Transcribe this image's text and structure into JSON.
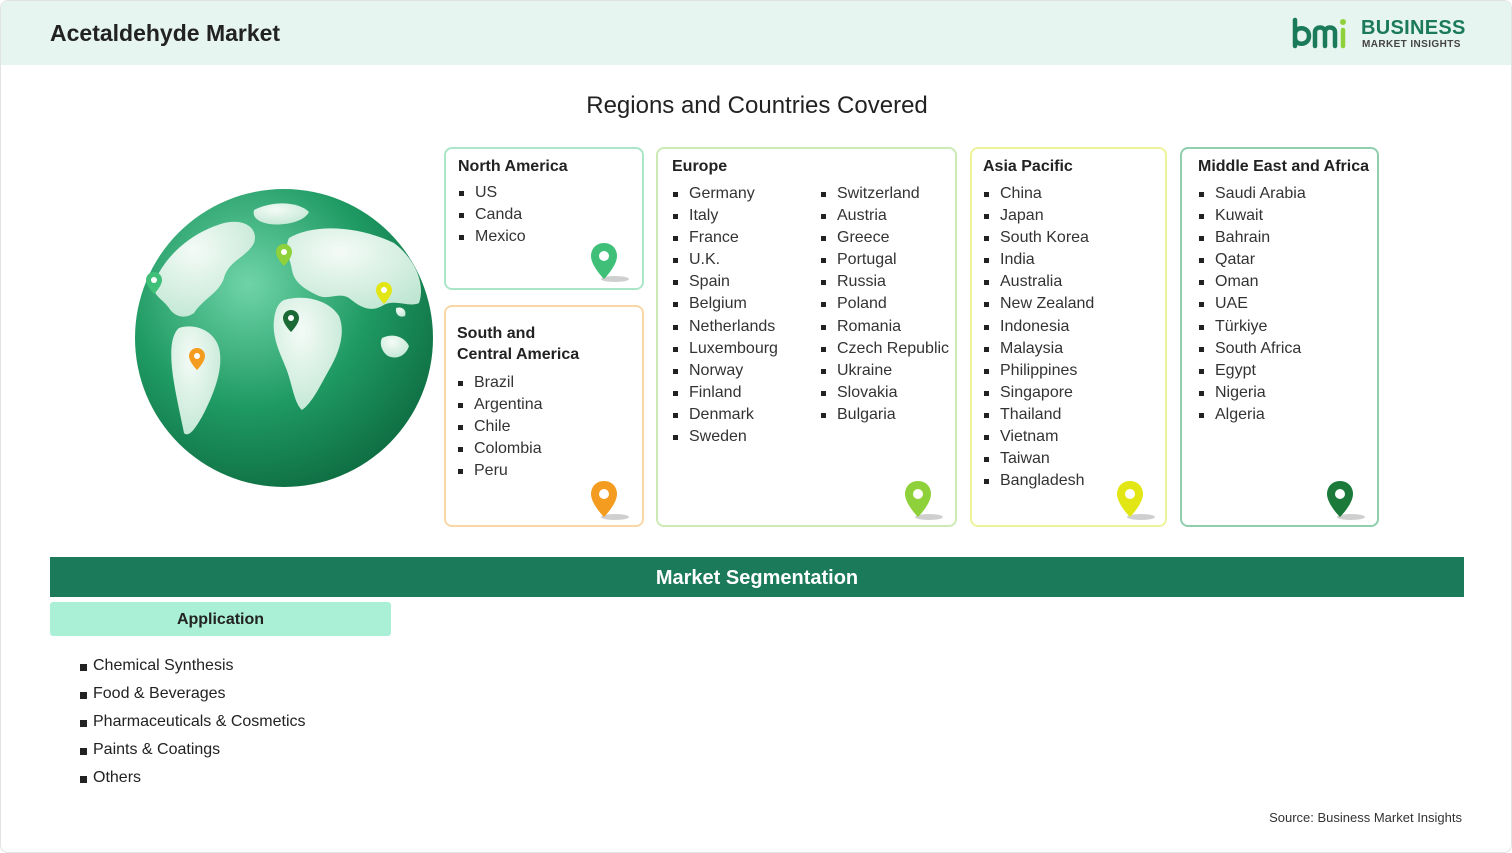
{
  "header": {
    "title": "Acetaldehyde Market"
  },
  "logo": {
    "line1": "BUSINESS",
    "line2": "MARKET INSIGHTS"
  },
  "regions_title": "Regions and Countries Covered",
  "regions": {
    "north_america": {
      "title": "North America",
      "pin_color": "#3fbf78",
      "items": [
        "US",
        "Canda",
        "Mexico"
      ]
    },
    "south_central_america": {
      "title_line1": "South and",
      "title_line2": "Central America",
      "pin_color": "#f39c1f",
      "items": [
        "Brazil",
        "Argentina",
        "Chile",
        "Colombia",
        "Peru"
      ]
    },
    "europe": {
      "title": "Europe",
      "pin_color": "#8fd13a",
      "col1": [
        "Germany",
        "Italy",
        "France",
        "U.K.",
        "Spain",
        "Belgium",
        "Netherlands",
        "Luxembourg",
        "Norway",
        "Finland",
        "Denmark",
        "Sweden"
      ],
      "col2": [
        "Switzerland",
        "Austria",
        "Greece",
        "Portugal",
        "Russia",
        "Poland",
        "Romania",
        "Czech Republic",
        "Ukraine",
        "Slovakia",
        "Bulgaria"
      ]
    },
    "asia_pacific": {
      "title": "Asia Pacific",
      "pin_color": "#e3e615",
      "items": [
        "China",
        "Japan",
        "South Korea",
        "India",
        "Australia",
        "New Zealand",
        "Indonesia",
        "Malaysia",
        "Philippines",
        "Singapore",
        "Thailand",
        "Vietnam",
        "Taiwan",
        "Bangladesh"
      ]
    },
    "mea": {
      "title": "Middle East and Africa",
      "pin_color": "#1b7a3a",
      "items": [
        "Saudi Arabia",
        "Kuwait",
        "Bahrain",
        "Qatar",
        "Oman",
        "UAE",
        "Türkiye",
        "South Africa",
        "Egypt",
        "Nigeria",
        "Algeria"
      ]
    }
  },
  "segmentation": {
    "title": "Market Segmentation",
    "tab": "Application",
    "items": [
      "Chemical Synthesis",
      "Food & Beverages",
      "Pharmaceuticals & Cosmetics",
      "Paints & Coatings",
      "Others"
    ]
  },
  "source": "Source: Business Market Insights",
  "colors": {
    "brand": "#1b7a5a",
    "header_bg": "#e6f5ef",
    "tab_bg": "#a9f0d6"
  }
}
